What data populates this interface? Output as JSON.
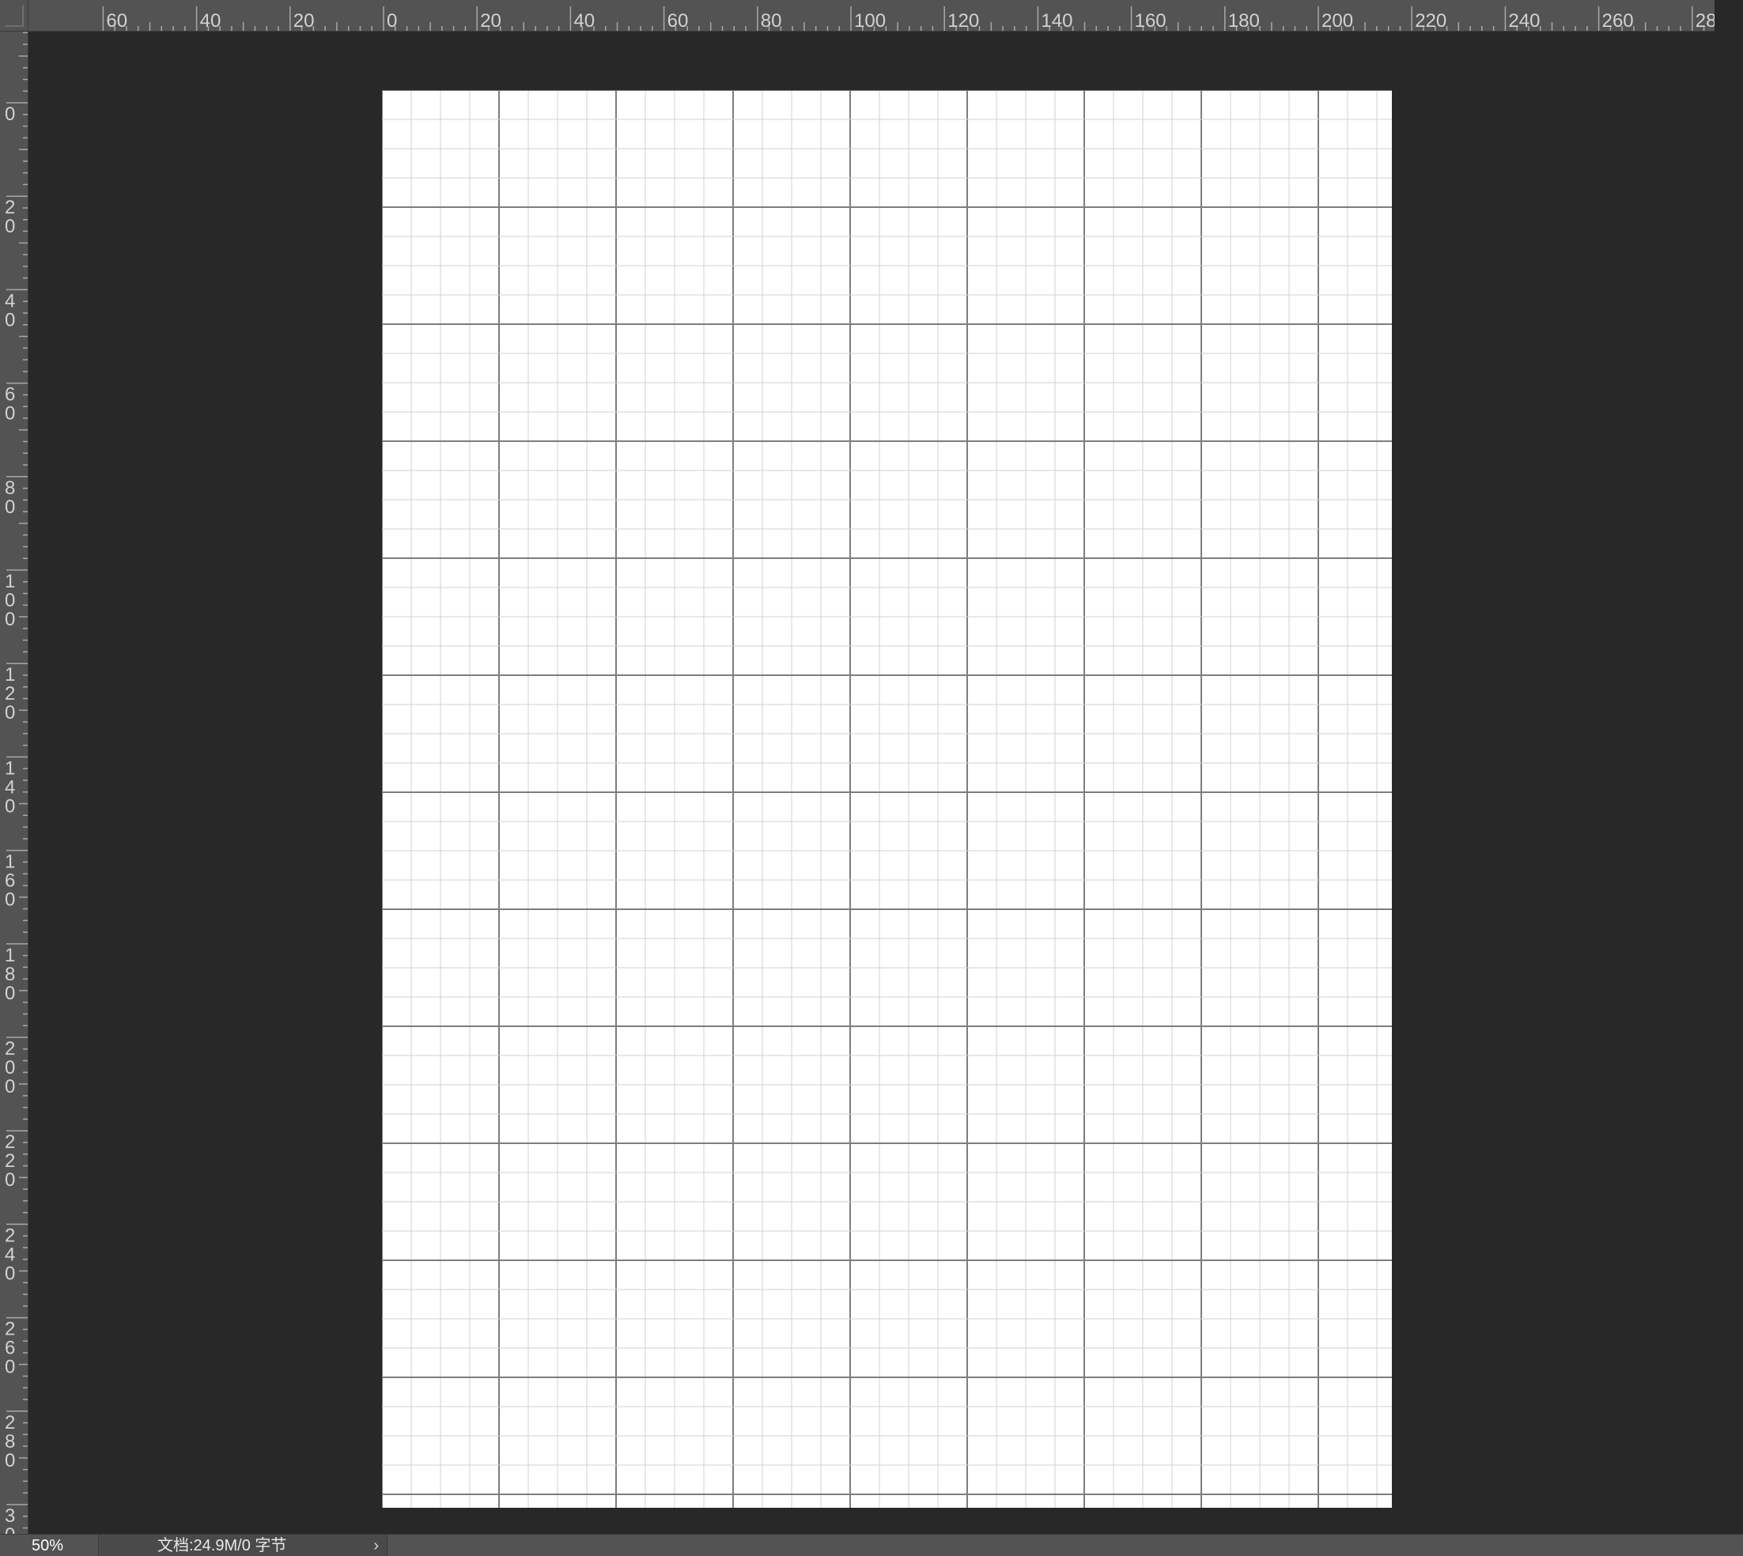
{
  "rulers": {
    "top_labels": [
      "60",
      "40",
      "20",
      "0",
      "20",
      "40",
      "60",
      "80",
      "100",
      "120",
      "140",
      "160",
      "180",
      "200",
      "220",
      "240",
      "260",
      "28"
    ],
    "left_labels": [
      "0",
      "20",
      "40",
      "60",
      "80",
      "100",
      "120",
      "140",
      "160",
      "180",
      "200",
      "220",
      "240",
      "260",
      "280",
      "30"
    ]
  },
  "status_bar": {
    "zoom": "50%",
    "doc_info": "文档:24.9M/0 字节",
    "arrow": "›"
  },
  "colors": {
    "workspace": "#282828",
    "ruler": "#535353",
    "canvas": "#ffffff",
    "grid_minor": "#cfd2d6",
    "grid_major": "#7d7d7d"
  },
  "icons": {
    "ruler_origin": "ruler-origin-icon",
    "status_menu": "chevron-right-icon"
  }
}
